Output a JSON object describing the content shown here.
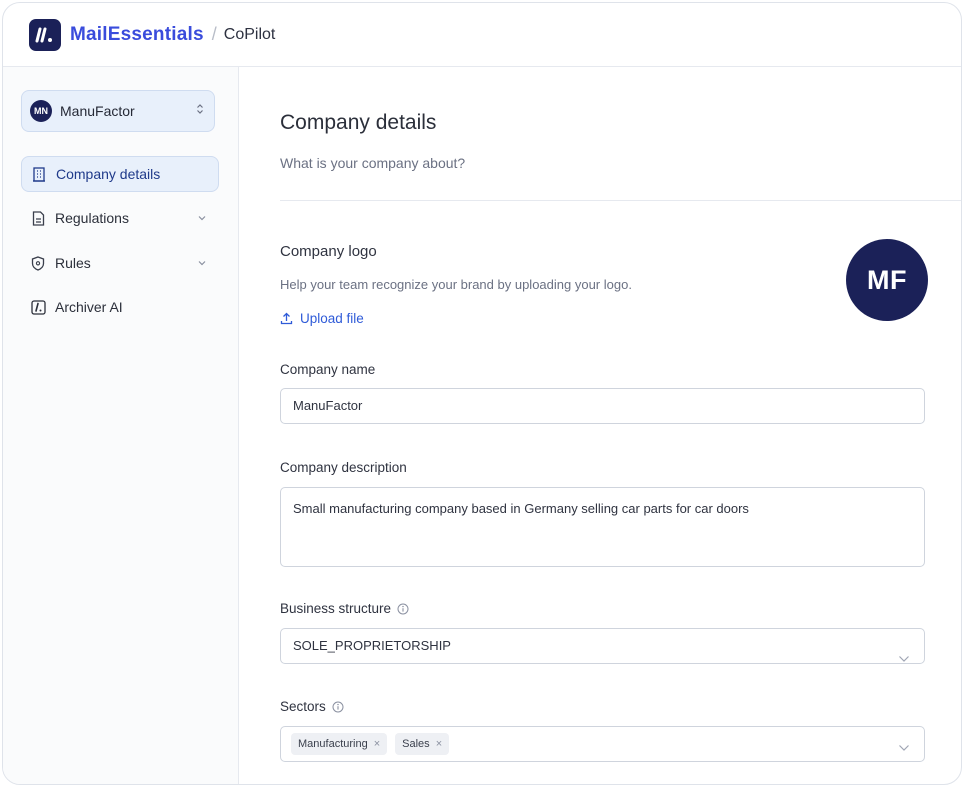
{
  "header": {
    "brand": "MailEssentials",
    "separator": "/",
    "page": "CoPilot"
  },
  "sidebar": {
    "org": {
      "initials": "MN",
      "name": "ManuFactor"
    },
    "items": [
      {
        "label": "Company details",
        "icon": "building-icon",
        "active": true
      },
      {
        "label": "Regulations",
        "icon": "document-icon",
        "expandable": true
      },
      {
        "label": "Rules",
        "icon": "shield-icon",
        "expandable": true
      },
      {
        "label": "Archiver AI",
        "icon": "archiver-logo-icon"
      }
    ]
  },
  "main": {
    "title": "Company details",
    "subtitle": "What is your company about?",
    "logo_section": {
      "label": "Company logo",
      "help": "Help your team recognize your brand by uploading your logo.",
      "upload_label": "Upload file",
      "avatar_initials": "MF"
    },
    "company_name": {
      "label": "Company name",
      "value": "ManuFactor"
    },
    "company_description": {
      "label": "Company description",
      "value": "Small manufacturing company based in Germany selling car parts for car doors"
    },
    "business_structure": {
      "label": "Business structure",
      "value": "SOLE_PROPRIETORSHIP"
    },
    "sectors": {
      "label": "Sectors",
      "chips": [
        "Manufacturing",
        "Sales"
      ],
      "remove_glyph": "×"
    }
  },
  "colors": {
    "brand_navy": "#1b2158",
    "brand_blue": "#3a4cdc",
    "link_blue": "#2f5bd8",
    "active_bg": "#e8f0fb"
  }
}
